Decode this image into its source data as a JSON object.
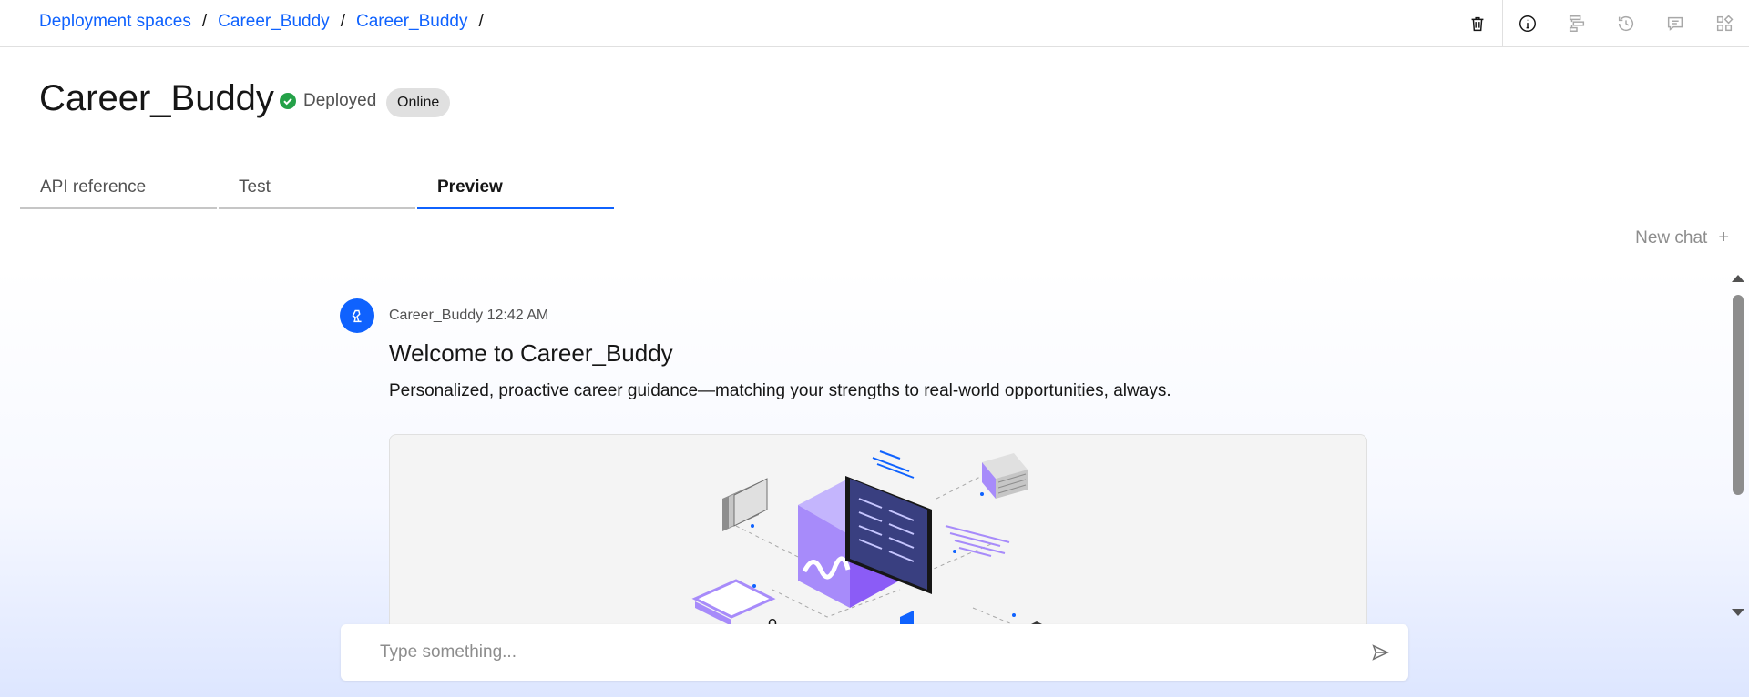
{
  "breadcrumb": [
    {
      "label": "Deployment spaces"
    },
    {
      "label": "Career_Buddy"
    },
    {
      "label": "Career_Buddy"
    }
  ],
  "breadcrumb_separator": "/",
  "toolbar": {
    "icons": [
      "trash-icon",
      "info-icon",
      "flow-icon",
      "history-icon",
      "comment-icon",
      "apps-icon"
    ]
  },
  "header": {
    "title": "Career_Buddy",
    "status": "Deployed",
    "tag": "Online"
  },
  "tabs": [
    {
      "label": "API reference",
      "active": false
    },
    {
      "label": "Test",
      "active": false
    },
    {
      "label": "Preview",
      "active": true
    }
  ],
  "new_chat": {
    "label": "New chat",
    "icon": "+"
  },
  "chat": {
    "sender": "Career_Buddy 12:42 AM",
    "welcome": "Welcome to Career_Buddy",
    "subtitle": "Personalized, proactive career guidance—matching your strengths to real-world opportunities, always."
  },
  "input": {
    "placeholder": "Type something...",
    "value": ""
  },
  "colors": {
    "accent": "#0f62fe",
    "success": "#24a148",
    "illustration_purple": "#a78bfa"
  }
}
